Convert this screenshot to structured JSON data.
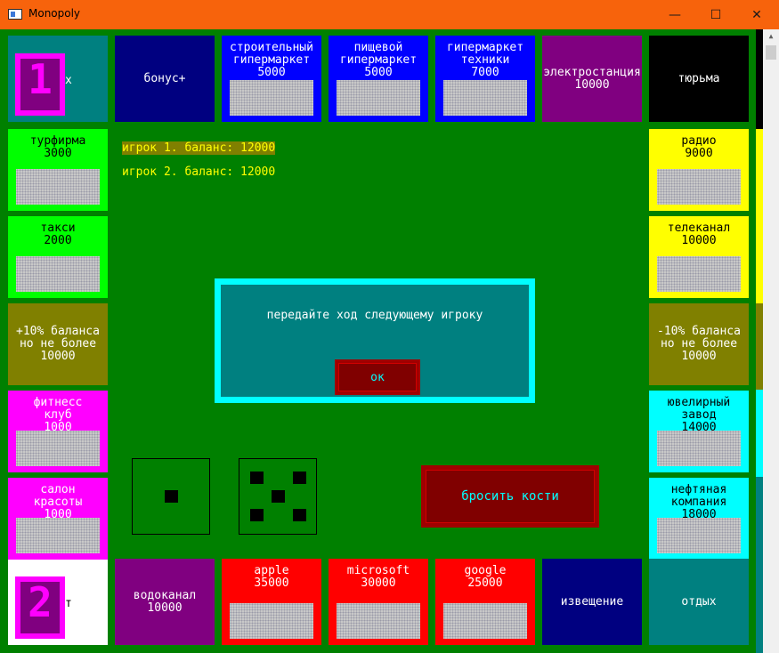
{
  "window": {
    "title": "Monopoly",
    "buttons": {
      "minimize": "—",
      "maximize": "☐",
      "close": "✕"
    }
  },
  "board": {
    "top": [
      {
        "name": "bonus",
        "text": "бонус+",
        "color": "#000080",
        "dark_text": false,
        "tex": false
      },
      {
        "name": "construction-hypermarket",
        "text": "строительный\nгипермаркет\n5000",
        "color": "#0000ff",
        "dark_text": false,
        "tex": true
      },
      {
        "name": "food-hypermarket",
        "text": "пищевой\nгипермаркет\n5000",
        "color": "#0000ff",
        "dark_text": false,
        "tex": true
      },
      {
        "name": "electronics-hypermarket",
        "text": "гипермаркет\nтехники\n7000",
        "color": "#0000ff",
        "dark_text": false,
        "tex": true
      },
      {
        "name": "power-plant",
        "text": "электростанция\n10000",
        "color": "#800080",
        "dark_text": false,
        "tex": false
      },
      {
        "name": "jail",
        "text": "тюрьма",
        "color": "#000000",
        "dark_text": false,
        "tex": false
      }
    ],
    "left": [
      {
        "name": "travel-agency",
        "text": "турфирма\n3000",
        "color": "#00ff00",
        "dark_text": true,
        "tex": true
      },
      {
        "name": "taxi",
        "text": "такси\n2000",
        "color": "#00ff00",
        "dark_text": true,
        "tex": true
      },
      {
        "name": "bonus-10",
        "text": "+10% баланса\nно не более\n10000",
        "color": "#808000",
        "dark_text": false,
        "tex": false
      },
      {
        "name": "fitness-club",
        "text": "фитнесс\nклуб\n1000",
        "color": "#ff00ff",
        "dark_text": false,
        "tex": true
      },
      {
        "name": "beauty-salon",
        "text": "салон\nкрасоты\n1000",
        "color": "#ff00ff",
        "dark_text": false,
        "tex": true
      }
    ],
    "right": [
      {
        "name": "radio",
        "text": "радио\n9000",
        "color": "#ffff00",
        "dark_text": true,
        "tex": true
      },
      {
        "name": "tv-channel",
        "text": "телеканал\n10000",
        "color": "#ffff00",
        "dark_text": true,
        "tex": true
      },
      {
        "name": "penalty-10",
        "text": "-10% баланса\nно не более\n10000",
        "color": "#808000",
        "dark_text": false,
        "tex": false
      },
      {
        "name": "jewelry-factory",
        "text": "ювелирный\nзавод\n14000",
        "color": "#00ffff",
        "dark_text": true,
        "tex": true
      },
      {
        "name": "oil-company",
        "text": "нефтяная\nкомпания\n18000",
        "color": "#00ffff",
        "dark_text": true,
        "tex": true
      }
    ],
    "bottom": [
      {
        "name": "water-utility",
        "text": "водоканал\n10000",
        "color": "#800080",
        "dark_text": false,
        "tex": false
      },
      {
        "name": "apple",
        "text": "apple\n35000",
        "color": "#ff0000",
        "dark_text": false,
        "tex": true
      },
      {
        "name": "microsoft",
        "text": "microsoft\n30000",
        "color": "#ff0000",
        "dark_text": false,
        "tex": true
      },
      {
        "name": "google",
        "text": "google\n25000",
        "color": "#ff0000",
        "dark_text": false,
        "tex": true
      },
      {
        "name": "notice",
        "text": "извещение",
        "color": "#000080",
        "dark_text": false,
        "tex": false
      },
      {
        "name": "rest",
        "text": "отдых",
        "color": "#008080",
        "dark_text": false,
        "tex": false
      }
    ],
    "corner_top_left": {
      "token": "1",
      "text": "х",
      "color": "#008080"
    },
    "corner_bottom_left": {
      "token": "2",
      "text": "т",
      "color": "#ffffff"
    }
  },
  "players": [
    {
      "text": "игрок 1. баланс: 12000",
      "active": true
    },
    {
      "text": "игрок 2. баланс: 12000",
      "active": false
    }
  ],
  "dialog": {
    "message": "передайте ход следующему игроку",
    "ok_label": "ок"
  },
  "dice": {
    "die1": 1,
    "die2": 5
  },
  "roll_button": "бросить кости",
  "edge_stripes": [
    "#000000",
    "#ffff00",
    "#808000",
    "#00ffff",
    "#008080"
  ]
}
